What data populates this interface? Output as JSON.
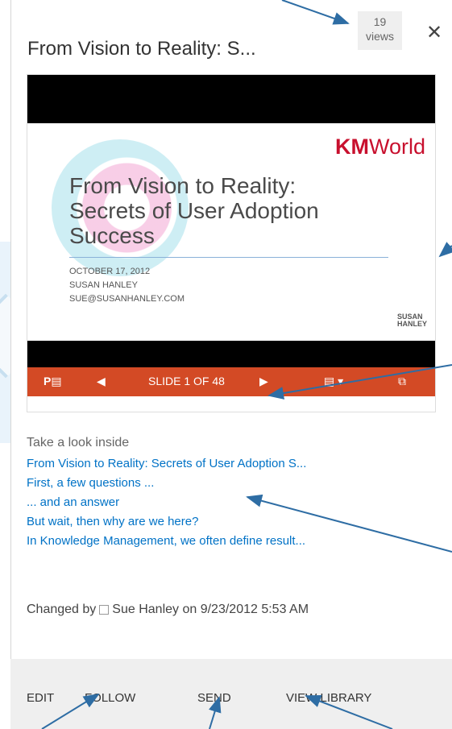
{
  "header": {
    "title": "From Vision to Reality: S...",
    "views_count": "19",
    "views_label": "views",
    "close_glyph": "✕"
  },
  "viewer": {
    "slide": {
      "brand_km": "KM",
      "brand_world": "World",
      "title_lines": [
        "From Vision to Reality:",
        "Secrets of User Adoption",
        "Success"
      ],
      "meta_lines": [
        "OCTOBER 17, 2012",
        "SUSAN HANLEY",
        "SUE@SUSANHANLEY.COM"
      ],
      "footer_logo": "SUSAN\nHANLEY"
    },
    "toolbar": {
      "app_icon": "P▤",
      "prev_icon": "◀",
      "slide_label": "SLIDE 1 OF 48",
      "next_icon": "▶",
      "notes_icon": "▤ ▾",
      "popout_icon": "⧉"
    }
  },
  "inside": {
    "heading": "Take a look inside",
    "links": [
      "From Vision to Reality: Secrets of User Adoption S...",
      "First, a few questions ...",
      "... and an answer",
      "But wait, then why are we here?",
      "In Knowledge Management, we often define result..."
    ]
  },
  "changed": {
    "prefix": "Changed by",
    "author": "Sue Hanley",
    "date_text": "on 9/23/2012 5:53 AM"
  },
  "footer": {
    "edit": "EDIT",
    "follow": "FOLLOW",
    "send": "SEND",
    "view_library": "VIEW LIBRARY"
  },
  "colors": {
    "accent_link": "#0072c6",
    "toolbar": "#d34a25",
    "arrow": "#2e6da4"
  }
}
